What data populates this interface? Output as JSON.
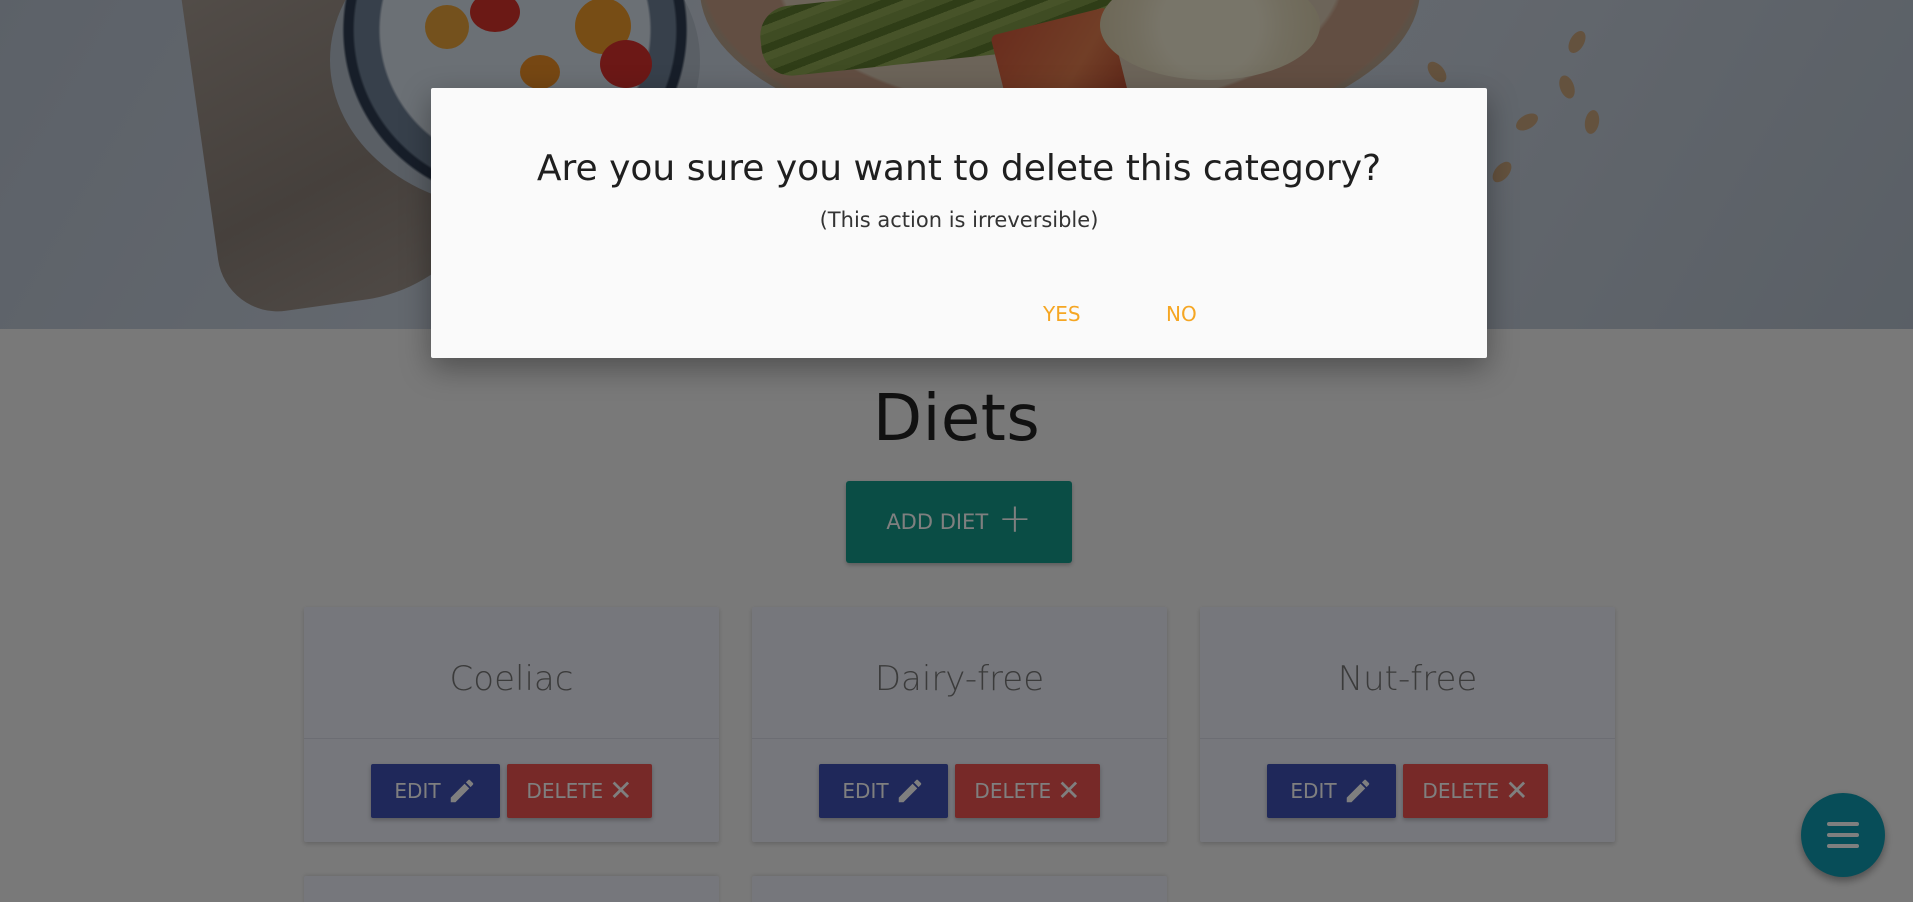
{
  "page": {
    "title": "Diets",
    "add_button": {
      "label": "ADD DIET",
      "icon": "plus-icon"
    }
  },
  "cards": [
    {
      "name": "Coeliac",
      "edit_label": "EDIT",
      "delete_label": "DELETE"
    },
    {
      "name": "Dairy-free",
      "edit_label": "EDIT",
      "delete_label": "DELETE"
    },
    {
      "name": "Nut-free",
      "edit_label": "EDIT",
      "delete_label": "DELETE"
    }
  ],
  "fab": {
    "icon": "hamburger-menu-icon"
  },
  "dialog": {
    "title": "Are you sure you want to delete this category?",
    "subtitle": "(This action is irreversible)",
    "yes_label": "YES",
    "no_label": "NO"
  },
  "colors": {
    "primary_teal": "#159b8a",
    "edit_blue": "#3f51b5",
    "delete_red": "#ef5350",
    "dialog_accent": "#f5a623",
    "fab": "#0f9bb0"
  }
}
